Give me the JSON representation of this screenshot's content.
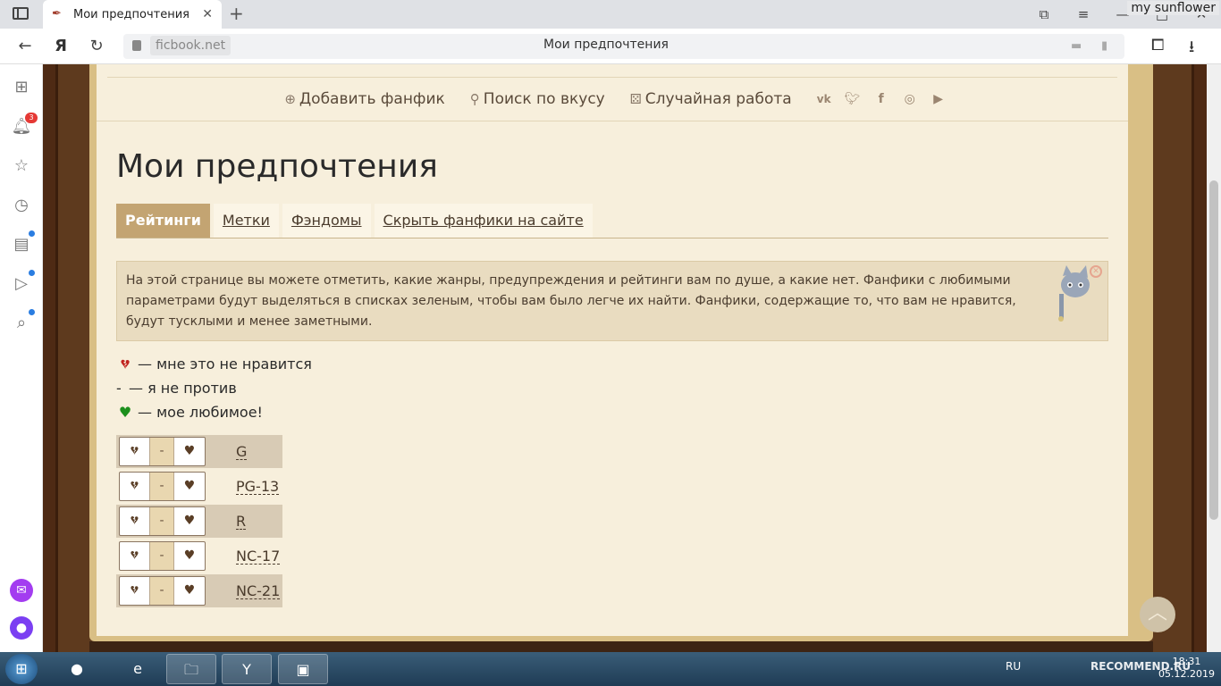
{
  "browser": {
    "tab_title": "Мои предпочтения",
    "domain": "ficbook.net",
    "page_title": "Мои предпочтения",
    "user_label": "my sunflower",
    "notification_count": "3"
  },
  "site_nav": {
    "add_fanfic": "Добавить фанфик",
    "search_by_taste": "Поиск по вкусу",
    "random_work": "Случайная работа",
    "social_icons": [
      "vk-icon",
      "twitter-icon",
      "facebook-icon",
      "instagram-icon",
      "youtube-icon"
    ]
  },
  "page": {
    "heading": "Мои предпочтения",
    "tabs": [
      {
        "label": "Рейтинги",
        "active": true
      },
      {
        "label": "Метки",
        "active": false
      },
      {
        "label": "Фэндомы",
        "active": false
      },
      {
        "label": "Скрыть фанфики на сайте",
        "active": false
      }
    ],
    "info_text": "На этой странице вы можете отметить, какие жанры, предупреждения и рейтинги вам по душе, а какие нет. Фанфики с любимыми параметрами будут выделяться в списках зеленым, чтобы вам было легче их найти. Фанфики, содержащие то, что вам не нравится, будут тусклыми и менее заметными.",
    "legend": {
      "dislike": "— мне это не нравится",
      "neutral_symbol": "-",
      "neutral": "— я не против",
      "favorite": "— мое любимое!"
    },
    "ratings": [
      {
        "label": "G"
      },
      {
        "label": "PG-13"
      },
      {
        "label": "R"
      },
      {
        "label": "NC-17"
      },
      {
        "label": "NC-21"
      }
    ],
    "rating_button_neutral": "-"
  },
  "taskbar": {
    "language": "RU",
    "time": "18:31",
    "date": "05.12.2019",
    "watermark": "RECOMMEND.RU"
  },
  "colors": {
    "accent_tab": "#c3a472",
    "paper": "#f7efdc",
    "frame": "#5e3a1e",
    "dislike_heart": "#c0221e",
    "favorite_heart": "#1c8f1c"
  }
}
